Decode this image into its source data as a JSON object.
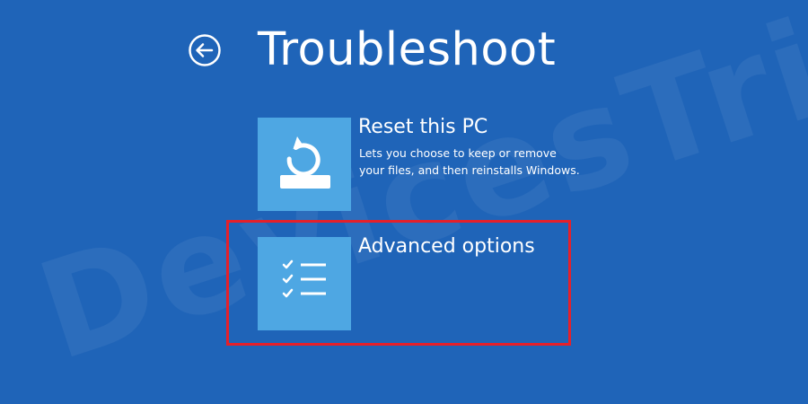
{
  "watermark": "DevicesTricks",
  "header": {
    "title": "Troubleshoot",
    "back_icon": "back-arrow-circle-icon"
  },
  "options": [
    {
      "title": "Reset this PC",
      "description_line1": "Lets you choose to keep or remove",
      "description_line2": "your files, and then reinstalls Windows.",
      "icon": "reset-pc-icon"
    },
    {
      "title": "Advanced options",
      "icon": "checklist-icon"
    }
  ],
  "colors": {
    "background": "#1f64b8",
    "tile": "#4ea7e3",
    "text": "#ffffff",
    "highlight": "#e5202a"
  }
}
